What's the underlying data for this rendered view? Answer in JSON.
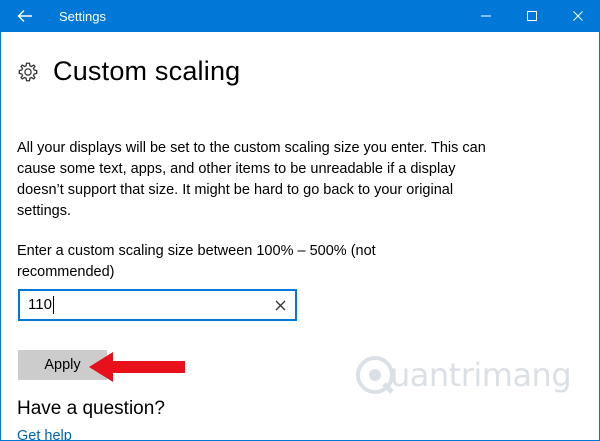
{
  "window": {
    "title": "Settings"
  },
  "page": {
    "title": "Custom scaling",
    "description": "All your displays will be set to the custom scaling size you enter. This can cause some text, apps, and other items to be unreadable if a display doesn’t support that size. It might be hard to go back to your original settings.",
    "prompt": "Enter a custom scaling size between 100% – 500% (not recommended)"
  },
  "input": {
    "value": "110"
  },
  "apply": {
    "label": "Apply"
  },
  "help": {
    "heading": "Have a question?",
    "link": "Get help"
  },
  "watermark": {
    "text": "uantrimang"
  },
  "colors": {
    "accent": "#0078d7",
    "button": "#cccccc",
    "arrow": "#e8101a",
    "link": "#0063b1"
  },
  "icons": {
    "back": "back-arrow-icon",
    "minimize": "minimize-icon",
    "maximize": "maximize-icon",
    "close": "close-icon",
    "page": "gear-icon",
    "clear": "clear-x-icon",
    "annotation": "red-arrow-icon",
    "watermark": "quantrimang-logo-icon"
  }
}
